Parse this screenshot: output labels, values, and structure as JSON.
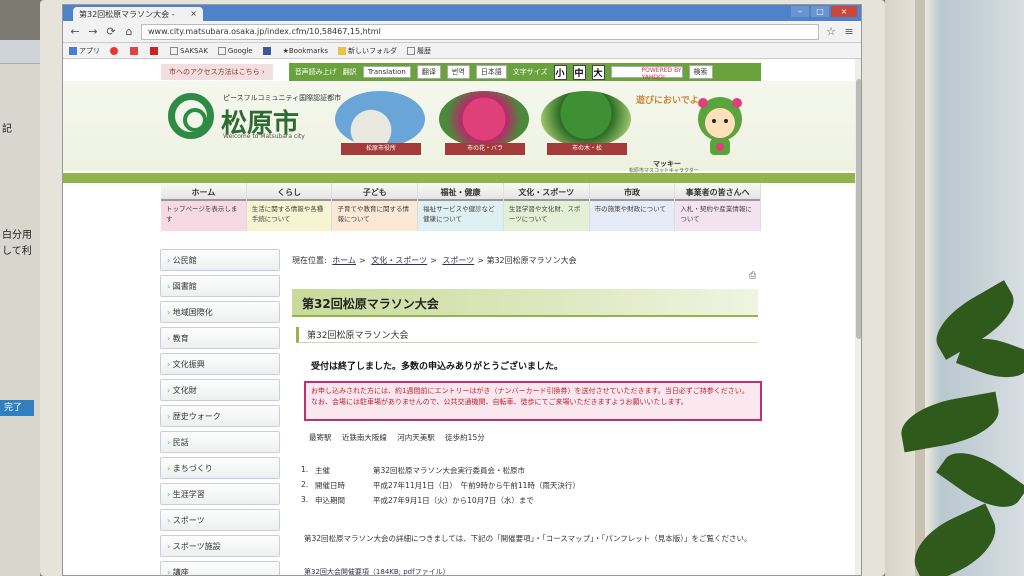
{
  "left_screen": {
    "lines": [
      "記",
      "白分用",
      "して利"
    ],
    "done_button": "完了"
  },
  "browser": {
    "tab_title": "第32回松原マラソン大会 -",
    "tab_close": "×",
    "url": "www.city.matsubara.osaka.jp/index.cfm/10,58467,15,html",
    "window_min": "–",
    "window_max": "□",
    "window_close": "×",
    "bookmarks": [
      {
        "label": "アプリ",
        "icon": "apps-icon"
      },
      {
        "label": "SAKSAK",
        "icon": "page-icon"
      },
      {
        "label": "Google",
        "icon": "page-icon"
      },
      {
        "label": "Bookmarks",
        "icon": "star-icon"
      },
      {
        "label": "新しいフォルダ",
        "icon": "folder-icon"
      },
      {
        "label": "履歴",
        "icon": "page-icon"
      }
    ]
  },
  "utility": {
    "access_link": "市へのアクセス方法はこちら ›",
    "voice": "音声読み上げ",
    "translate_label": "翻訳",
    "translate_buttons": [
      "Translation",
      "翻译",
      "번역",
      "日本語"
    ],
    "font_size_label": "文字サイズ",
    "font_sizes": [
      "小",
      "中",
      "大"
    ],
    "search_placeholder": "POWERED BY YAHOO!",
    "search_button": "検索"
  },
  "header": {
    "city_subtitle": "ピースフルコミュニティ国際認証都市",
    "city_name": "松原市",
    "city_english": "Welcome to Matsubara city",
    "photos": [
      "松原市役所",
      "市の花・バラ",
      "市の木・松"
    ],
    "mascot_callout": "遊びにおいでよ",
    "mascot_name": "マッキー",
    "mascot_sub": "松原市マスコットキャラクター"
  },
  "nav": [
    {
      "label": "ホーム",
      "desc": "トップページを表示します"
    },
    {
      "label": "くらし",
      "desc": "生活に関する情報や各種手続について"
    },
    {
      "label": "子ども",
      "desc": "子育てや教育に関する情報について"
    },
    {
      "label": "福祉・健康",
      "desc": "福祉サービスや健診など健康について"
    },
    {
      "label": "文化・スポーツ",
      "desc": "生涯学習や文化財、スポーツについて"
    },
    {
      "label": "市政",
      "desc": "市の施策や財政について"
    },
    {
      "label": "事業者の皆さんへ",
      "desc": "入札・契約や産業情報について"
    }
  ],
  "sidebar": [
    "公民館",
    "図書館",
    "地域国際化",
    "教育",
    "文化振興",
    "文化財",
    "歴史ウォーク",
    "民話",
    "まちづくり",
    "生涯学習",
    "スポーツ",
    "スポーツ施設",
    "講座"
  ],
  "content": {
    "breadcrumb_prefix": "現在位置:",
    "breadcrumb_links": [
      "ホーム",
      "文化・スポーツ",
      "スポーツ"
    ],
    "breadcrumb_current": "第32回松原マラソン大会",
    "print_icon": "⎙",
    "title": "第32回松原マラソン大会",
    "subtitle": "第32回松原マラソン大会",
    "notice": "受付は終了しました。多数の申込みありがとうございました。",
    "alert": "お申し込みされた方には、約1週間前にエントリーはがき（ナンバーカード引換券）を送付させていただきます。当日必ずご持参ください。なお、会場には駐車場がありませんので、公共交通機関、自転車、徒歩にてご来場いただきますようお願いいたします。",
    "access": [
      "最寄駅",
      "近鉄南大阪線",
      "河内天美駅",
      "徒歩約15分"
    ],
    "info": [
      {
        "num": "1.",
        "label": "主催",
        "value": "第32回松原マラソン大会実行委員会・松原市"
      },
      {
        "num": "2.",
        "label": "開催日時",
        "value": "平成27年11月1日（日）　午前9時から午前11時（雨天決行）"
      },
      {
        "num": "3.",
        "label": "申込期間",
        "value": "平成27年9月1日（火）から10月7日（水）まで"
      }
    ],
    "detail": "第32回松原マラソン大会の詳細につきましては、下記の「開催要項」・「コースマップ」・「パンフレット（見本版）」をご覧ください。",
    "pdf_link": "第32回大会開催要項（184KB; pdfファイル）"
  },
  "colors": {
    "accent_green": "#8fb54b",
    "city_green": "#2d6b33",
    "alert_border": "#c0306e",
    "chrome_blue": "#4f83c9"
  }
}
